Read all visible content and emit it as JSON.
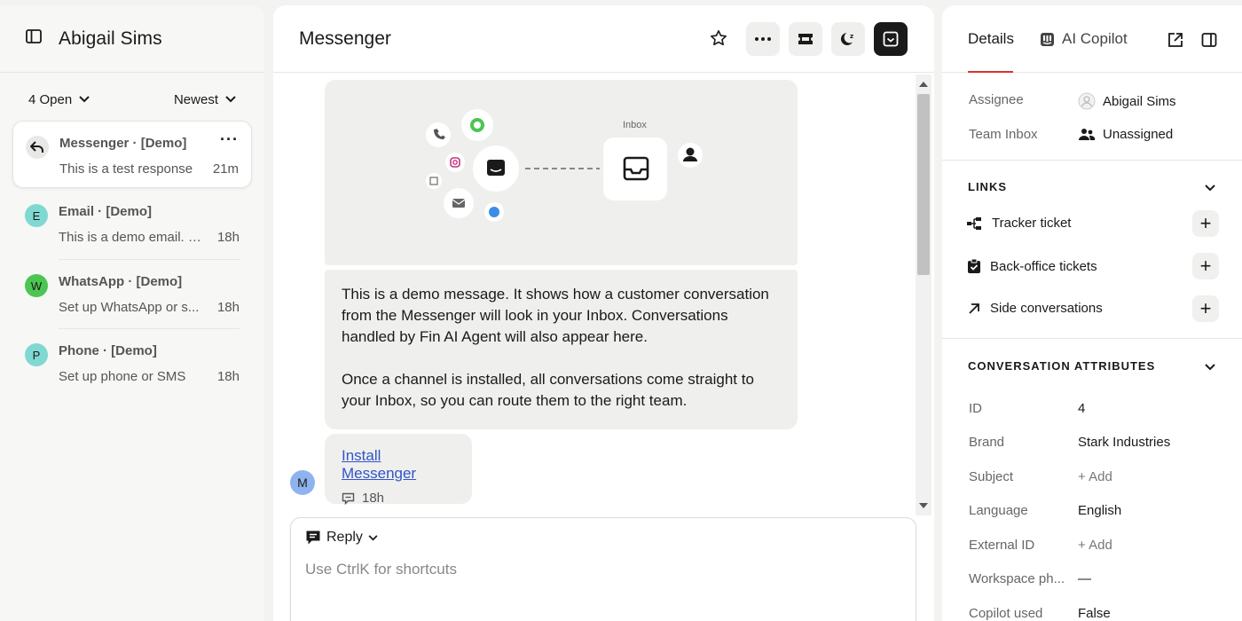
{
  "left": {
    "title": "Abigail Sims",
    "filter_status": "4 Open",
    "filter_sort": "Newest",
    "conversations": [
      {
        "avatar": "",
        "name": "Messenger · [Demo]",
        "snippet": "This is a test response",
        "time": "21m"
      },
      {
        "avatar": "E",
        "name": "Email · [Demo]",
        "snippet": "This is a demo email. It...",
        "time": "18h"
      },
      {
        "avatar": "W",
        "name": "WhatsApp · [Demo]",
        "snippet": "Set up WhatsApp or s...",
        "time": "18h"
      },
      {
        "avatar": "P",
        "name": "Phone · [Demo]",
        "snippet": "Set up phone or SMS",
        "time": "18h"
      }
    ]
  },
  "mid": {
    "title": "Messenger",
    "inbox_label": "Inbox",
    "message_p1": "This is a demo message. It shows how a customer conversation from the Messenger will look in your Inbox. Conversations handled by Fin AI Agent will also appear here.",
    "message_p2": "Once a channel is installed, all conversations come straight to your Inbox, so you can route them to the right team.",
    "link_text": "Install Messenger",
    "link_time": "18h",
    "avatar": "M",
    "reply_label": "Reply",
    "reply_placeholder": "Use CtrlK for shortcuts"
  },
  "right": {
    "tab_details": "Details",
    "tab_copilot": "AI Copilot",
    "assignee_label": "Assignee",
    "assignee_value": "Abigail Sims",
    "team_label": "Team Inbox",
    "team_value": "Unassigned",
    "links_title": "LINKS",
    "links": [
      "Tracker ticket",
      "Back-office tickets",
      "Side conversations"
    ],
    "attrs_title": "CONVERSATION ATTRIBUTES",
    "attributes": [
      {
        "label": "ID",
        "value": "4"
      },
      {
        "label": "Brand",
        "value": "Stark Industries"
      },
      {
        "label": "Subject",
        "value": "+ Add"
      },
      {
        "label": "Language",
        "value": "English"
      },
      {
        "label": "External ID",
        "value": "+ Add"
      },
      {
        "label": "Workspace ph...",
        "value": "—"
      },
      {
        "label": "Copilot used",
        "value": "False"
      }
    ]
  },
  "colors": {
    "accent": "#d9342b",
    "link": "#2f55c9",
    "avatar_e": "#7fd9d2",
    "avatar_w": "#4cc552",
    "avatar_p": "#7fd9d2",
    "avatar_m": "#8fb3ef"
  }
}
